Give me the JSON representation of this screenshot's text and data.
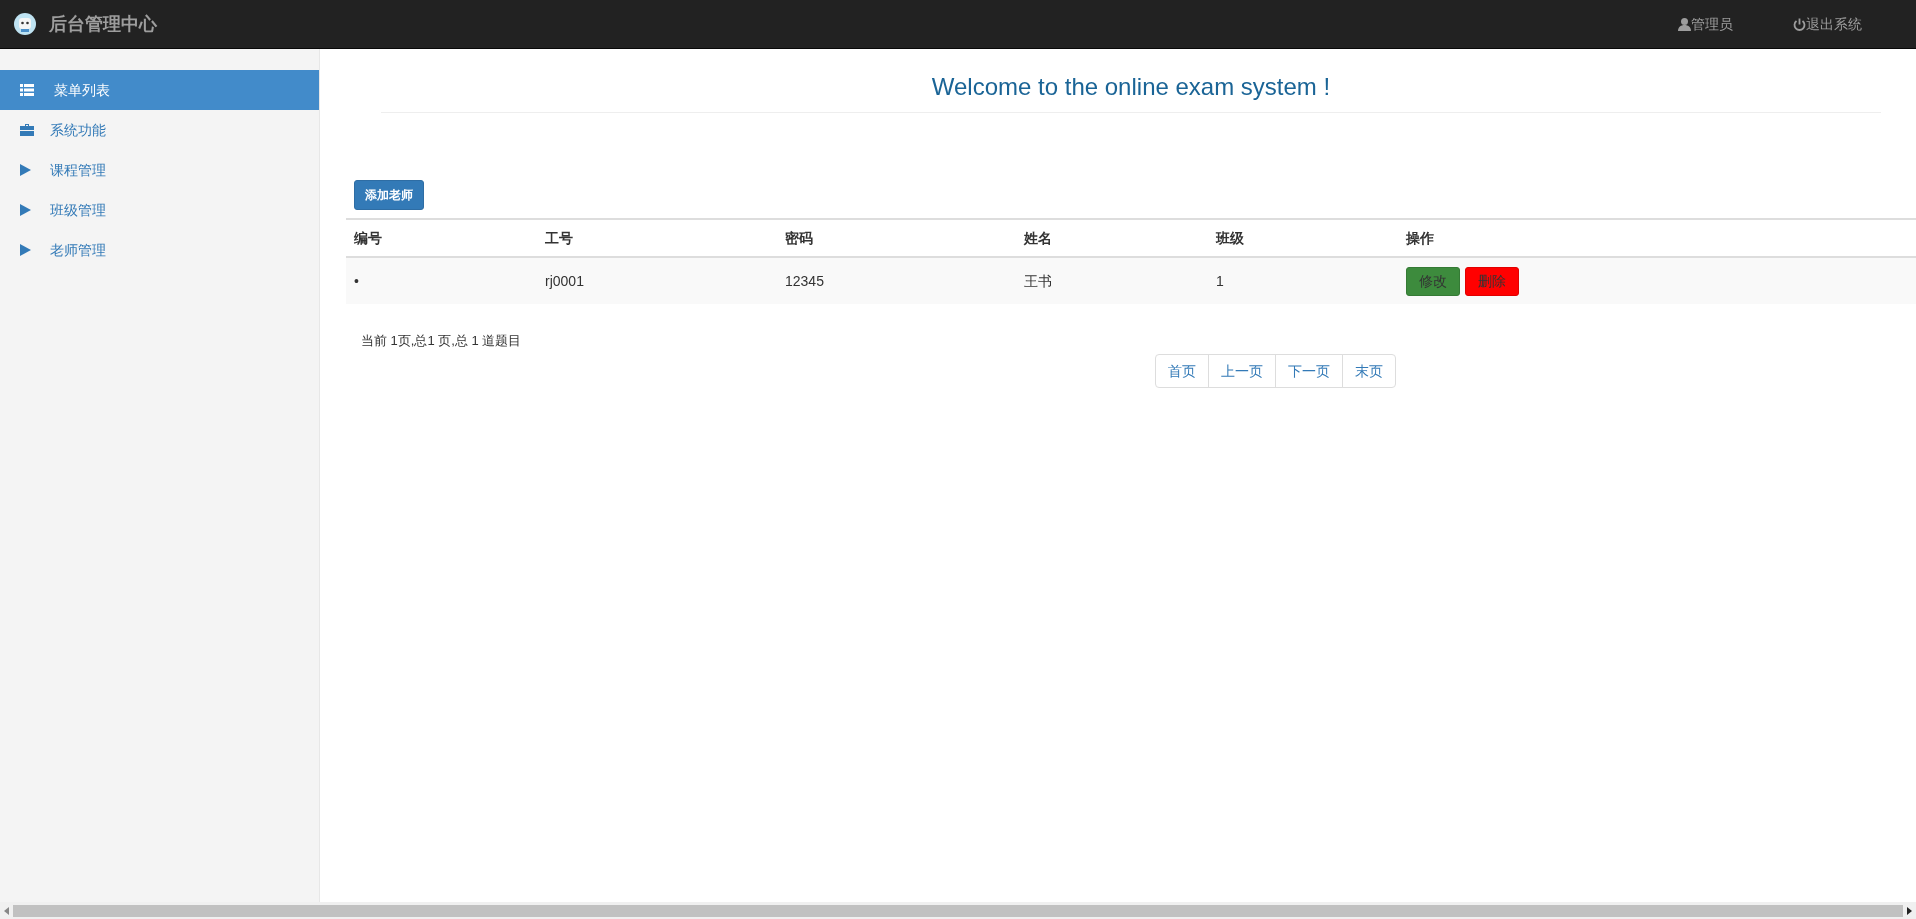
{
  "header": {
    "title": "后台管理中心",
    "user": "管理员",
    "logout": "退出系统"
  },
  "sidebar": {
    "items": [
      {
        "label": "菜单列表",
        "kind": "list",
        "selected": true
      },
      {
        "label": "系统功能",
        "kind": "briefcase",
        "selected": false
      },
      {
        "label": "课程管理",
        "kind": "triangle",
        "selected": false
      },
      {
        "label": "班级管理",
        "kind": "triangle",
        "selected": false
      },
      {
        "label": "老师管理",
        "kind": "triangle",
        "selected": false
      }
    ]
  },
  "page": {
    "heading": "Welcome to the online exam system !",
    "add_button": "添加老师"
  },
  "table": {
    "columns": [
      "编号",
      "工号",
      "密码",
      "姓名",
      "班级",
      "操作"
    ],
    "rows": [
      {
        "cells": [
          "•",
          "rj0001",
          "12345",
          "王书",
          "1"
        ],
        "actions": [
          {
            "label": "修改",
            "kind": "edit"
          },
          {
            "label": "删除",
            "kind": "delete"
          }
        ]
      }
    ]
  },
  "pagination": {
    "summary": "当前 1页,总1 页,总 1 道题目",
    "links": [
      "首页",
      "上一页",
      "下一页",
      "末页"
    ]
  }
}
